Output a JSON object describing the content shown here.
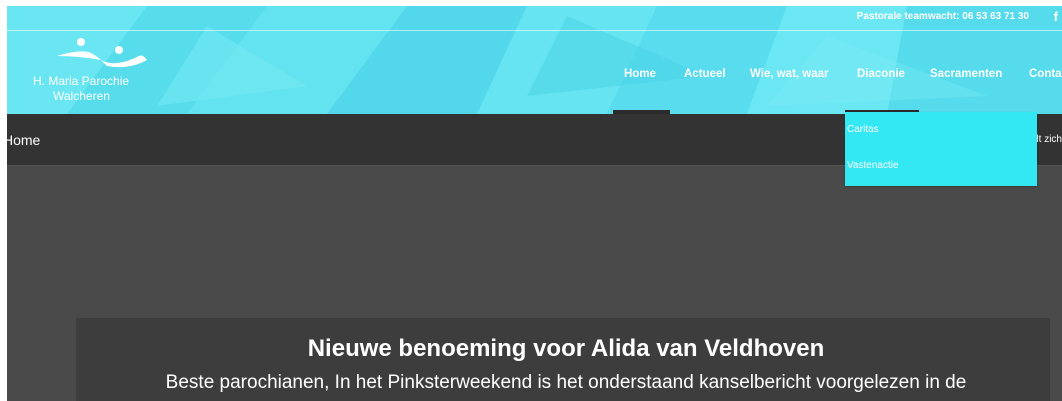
{
  "topbar": {
    "phone_text": "Pastorale teamwacht: 06 53 63 71 30",
    "facebook_icon": "facebook-icon"
  },
  "logo": {
    "line1": "H. Maria Parochie",
    "line2": "Walcheren"
  },
  "nav": {
    "items": [
      {
        "label": "Home",
        "active": true
      },
      {
        "label": "Actueel"
      },
      {
        "label": "Wie, wat, waar"
      },
      {
        "label": "Diaconie",
        "open": true
      },
      {
        "label": "Sacramenten"
      },
      {
        "label": "Conta"
      }
    ]
  },
  "dropdown": {
    "items": [
      "Caritas",
      "Vastenactie"
    ]
  },
  "breadcrumb": {
    "title": "Home",
    "right_text": "dt zich"
  },
  "hero": {
    "title": "Nieuwe benoeming voor Alida van Veldhoven",
    "text": "Beste parochianen, In het Pinksterweekend is het onderstaand kanselbericht voorgelezen in de"
  },
  "colors": {
    "header": "#5ee0ee",
    "dropdown": "#33e7f3",
    "dark_bar": "#333333",
    "hero": "#4a4a4a"
  }
}
